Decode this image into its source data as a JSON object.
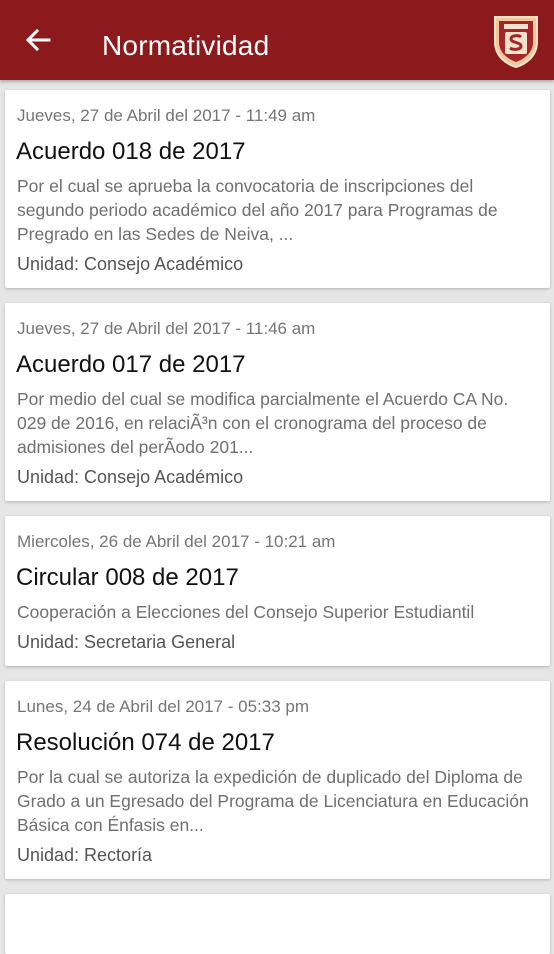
{
  "header": {
    "title": "Normatividad",
    "back_icon": "arrow-back-icon",
    "logo_icon": "university-shield-logo",
    "background_color": "#8c1a1c"
  },
  "items": [
    {
      "date": "Jueves, 27 de Abril del 2017 - 11:49 am",
      "title": "Acuerdo 018 de 2017",
      "summary": "Por el cual se aprueba la convocatoria de inscripciones del segundo periodo académico del año 2017 para Programas de Pregrado en las Sedes de Neiva, ...",
      "unit": "Unidad: Consejo Académico"
    },
    {
      "date": "Jueves, 27 de Abril del 2017 - 11:46 am",
      "title": "Acuerdo 017 de 2017",
      "summary": "Por medio del cual se modifica parcialmente el Acuerdo CA No. 029 de 2016,  en relaciÃ³n con el cronograma del proceso de admisiones del perÃodo 201...",
      "unit": "Unidad: Consejo Académico"
    },
    {
      "date": "Miercoles, 26 de Abril del 2017 - 10:21 am",
      "title": "Circular 008 de 2017",
      "summary": "Cooperación a Elecciones del Consejo Superior Estudiantil",
      "unit": "Unidad: Secretaria General"
    },
    {
      "date": "Lunes, 24 de Abril del 2017 - 05:33 pm",
      "title": "Resolución 074 de 2017",
      "summary": "Por la cual se autoriza la expedición de duplicado del Diploma de Grado a un Egresado del Programa de Licenciatura en Educación Básica con Énfasis en...",
      "unit": "Unidad: Rectoría"
    }
  ]
}
